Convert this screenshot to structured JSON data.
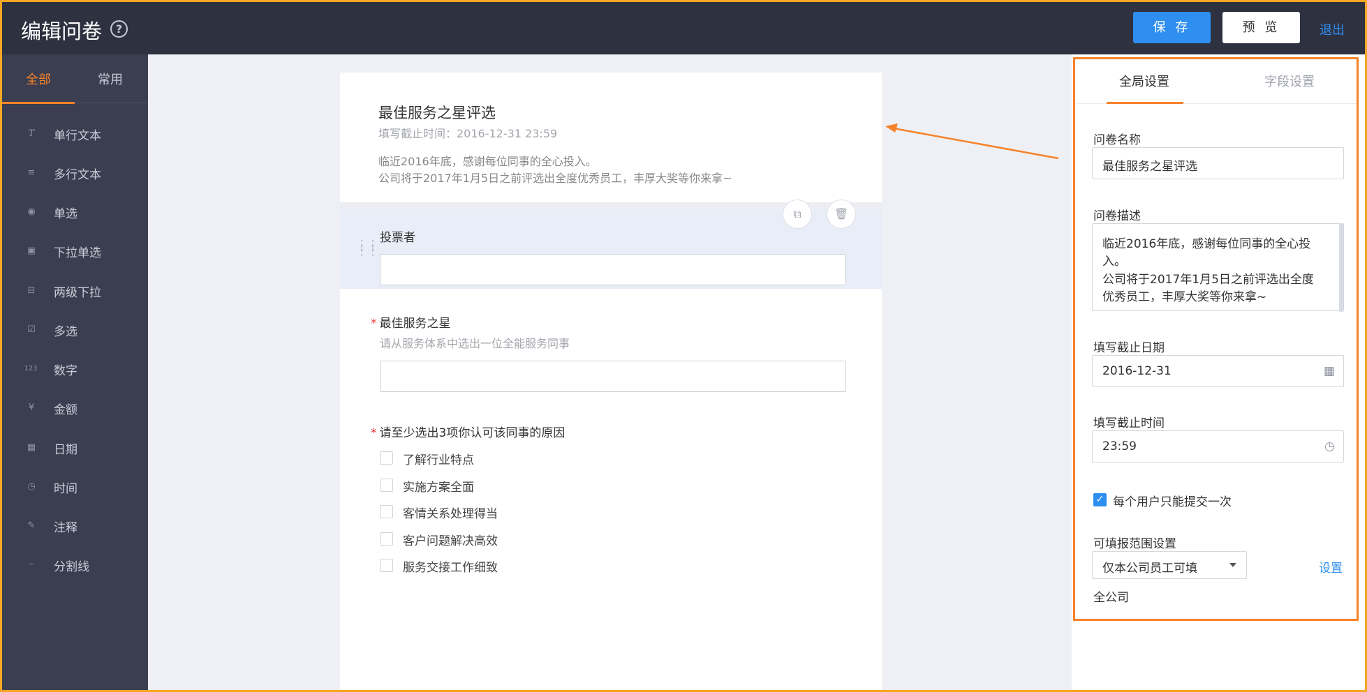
{
  "header": {
    "title": "编辑问卷",
    "help_icon": "?",
    "save_label": "保 存",
    "preview_label": "预 览",
    "exit_label": "退出"
  },
  "sidebar": {
    "tabs": [
      {
        "label": "全部",
        "active": true
      },
      {
        "label": "常用",
        "active": false
      }
    ],
    "items": [
      {
        "icon": "text-icon",
        "glyph": "T",
        "label": "单行文本"
      },
      {
        "icon": "multiline-icon",
        "glyph": "≡",
        "label": "多行文本"
      },
      {
        "icon": "radio-icon",
        "glyph": "◉",
        "label": "单选"
      },
      {
        "icon": "dropdown-icon",
        "glyph": "▣",
        "label": "下拉单选"
      },
      {
        "icon": "cascade-dropdown-icon",
        "glyph": "⊟",
        "label": "两级下拉"
      },
      {
        "icon": "checkbox-icon",
        "glyph": "☑",
        "label": "多选"
      },
      {
        "icon": "number-icon",
        "glyph": "123",
        "label": "数字"
      },
      {
        "icon": "currency-icon",
        "glyph": "¥",
        "label": "金额"
      },
      {
        "icon": "calendar-icon",
        "glyph": "▦",
        "label": "日期"
      },
      {
        "icon": "clock-icon",
        "glyph": "◷",
        "label": "时间"
      },
      {
        "icon": "pin-icon",
        "glyph": "✎",
        "label": "注释"
      },
      {
        "icon": "divider-icon",
        "glyph": "┄",
        "label": "分割线"
      }
    ]
  },
  "form": {
    "title": "最佳服务之星评选",
    "deadline": "填写截止时间：2016-12-31 23:59",
    "desc_line1": "临近2016年底，感谢每位同事的全心投入。",
    "desc_line2": "公司将于2017年1月5日之前评选出全度优秀员工，丰厚大奖等你来拿~",
    "fields": [
      {
        "label": "投票者",
        "required": false
      },
      {
        "label": "最佳服务之星",
        "required": true,
        "help": "请从服务体系中选出一位全能服务同事"
      },
      {
        "label": "请至少选出3项你认可该同事的原因",
        "required": true,
        "options": [
          "了解行业特点",
          "实施方案全面",
          "客情关系处理得当",
          "客户问题解决高效",
          "服务交接工作细致"
        ]
      }
    ],
    "required_mark": "*"
  },
  "panel": {
    "tabs": [
      {
        "label": "全局设置",
        "active": true
      },
      {
        "label": "字段设置",
        "active": false
      }
    ],
    "name_label": "问卷名称",
    "name_value": "最佳服务之星评选",
    "desc_label": "问卷描述",
    "desc_lines": [
      "临近2016年底，感谢每位同事的全心投",
      "入。",
      "公司将于2017年1月5日之前评选出全度",
      "优秀员工，丰厚大奖等你来拿~"
    ],
    "date_label": "填写截止日期",
    "date_value": "2016-12-31",
    "time_label": "填写截止时间",
    "time_value": "23:59",
    "once_label": "每个用户只能提交一次",
    "once_checked": true,
    "scope_label": "可填报范围设置",
    "scope_value": "仅本公司员工可填",
    "scope_link": "设置",
    "scope_note": "全公司"
  },
  "colors": {
    "accent": "#f5822a",
    "primary": "#2f8ff0",
    "header_bg": "#2e3140",
    "sidebar_bg": "#3a3e50"
  }
}
